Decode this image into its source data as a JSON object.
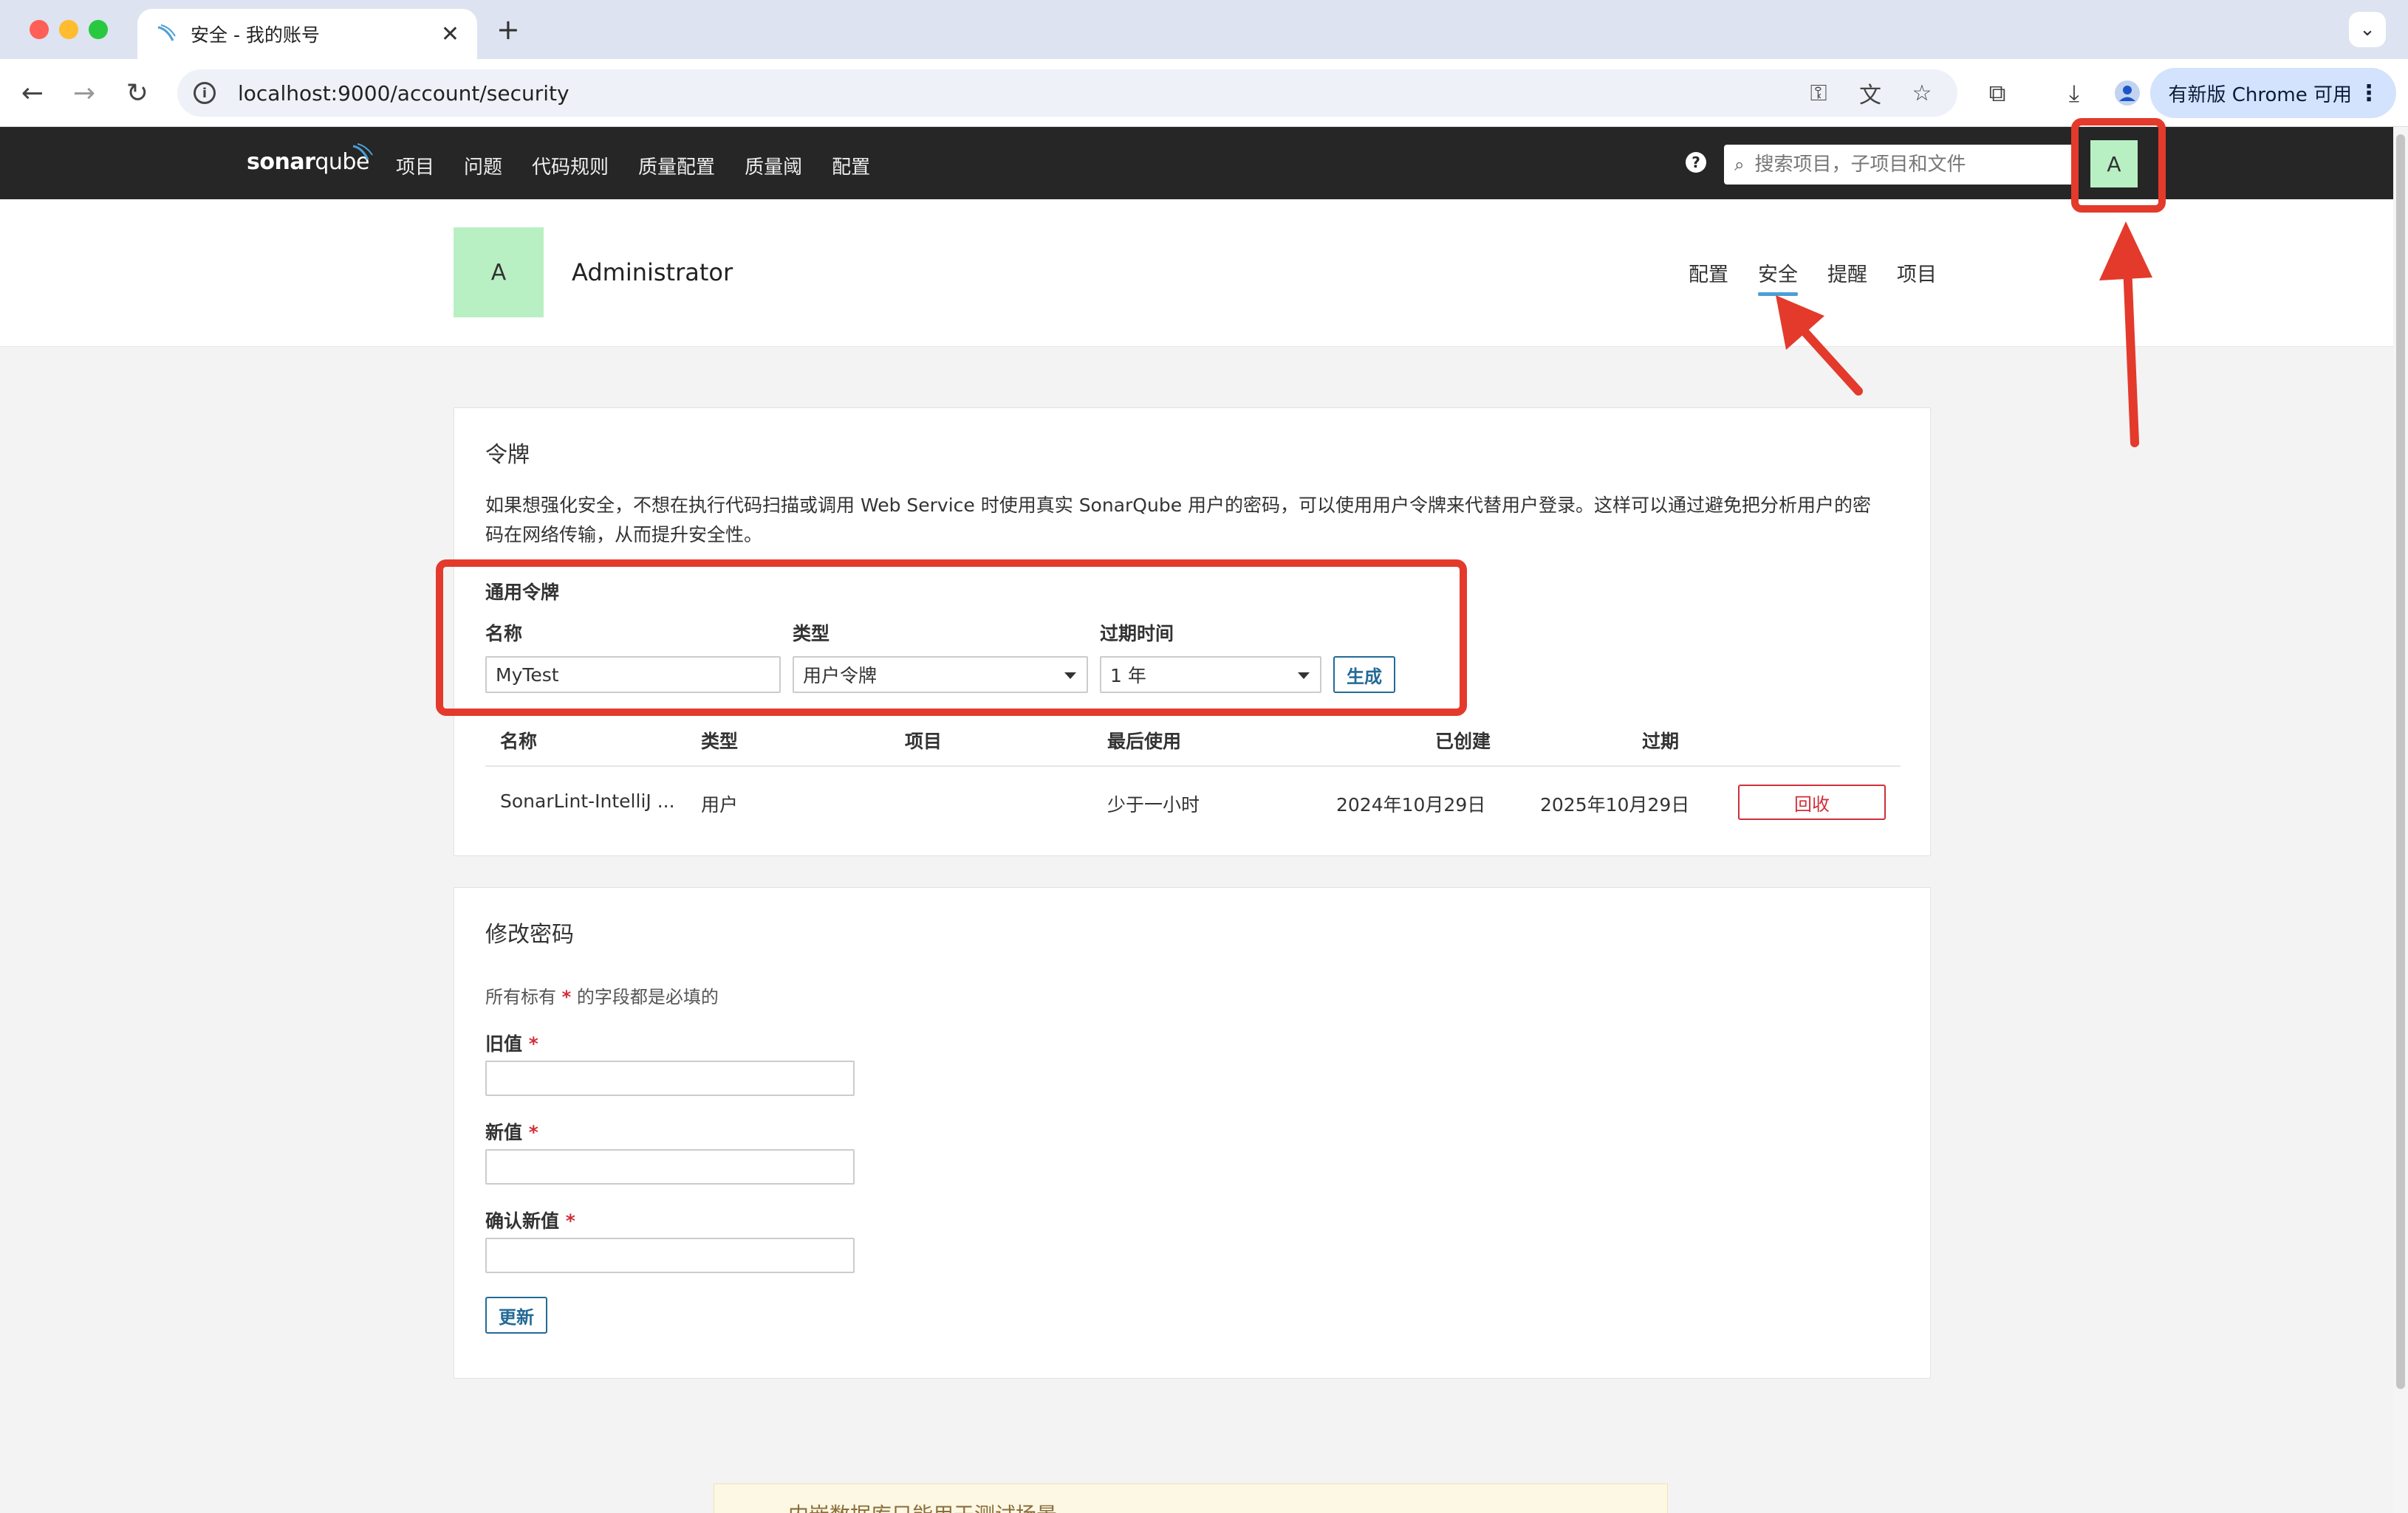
{
  "browser": {
    "tab_title": "安全 - 我的账号",
    "url": "localhost:9000/account/security",
    "update_label": "有新版 Chrome 可用"
  },
  "sonar": {
    "logo_bold": "sonar",
    "logo_thin": "qube",
    "menu": [
      "项目",
      "问题",
      "代码规则",
      "质量配置",
      "质量阈",
      "配置"
    ],
    "search_placeholder": "搜索项目，子项目和文件",
    "avatar_letter": "A"
  },
  "account": {
    "avatar_letter": "A",
    "name": "Administrator",
    "tabs": [
      "配置",
      "安全",
      "提醒",
      "项目"
    ],
    "active_tab": "安全"
  },
  "tokens": {
    "title": "令牌",
    "description": "如果想强化安全，不想在执行代码扫描或调用 Web Service 时使用真实 SonarQube 用户的密码，可以使用用户令牌来代替用户登录。这样可以通过避免把分析用户的密码在网络传输，从而提升安全性。",
    "generate_heading": "通用令牌",
    "name_label": "名称",
    "type_label": "类型",
    "expiry_label": "过期时间",
    "name_value": "MyTest",
    "type_value": "用户令牌",
    "expiry_value": "1 年",
    "generate_button": "生成",
    "table": {
      "headers": [
        "名称",
        "类型",
        "项目",
        "最后使用",
        "已创建",
        "过期"
      ],
      "rows": [
        {
          "name": "SonarLint-IntelliJ ...",
          "type": "用户",
          "project": "",
          "last_used": "少于一小时",
          "created": "2024年10月29日",
          "expires": "2025年10月29日",
          "revoke": "回收"
        }
      ]
    }
  },
  "password": {
    "title": "修改密码",
    "required_note_pre": "所有标有",
    "required_star": "*",
    "required_note_post": "的字段都是必填的",
    "old_label": "旧值",
    "new_label": "新值",
    "confirm_label": "确认新值",
    "update_button": "更新"
  },
  "footer": {
    "banner": "内嵌数据库只能用于测试场景"
  },
  "colors": {
    "annotation": "#e33a2c",
    "accent": "#236a97",
    "avatar": "#b9f0c3",
    "danger": "#d02f3a"
  }
}
